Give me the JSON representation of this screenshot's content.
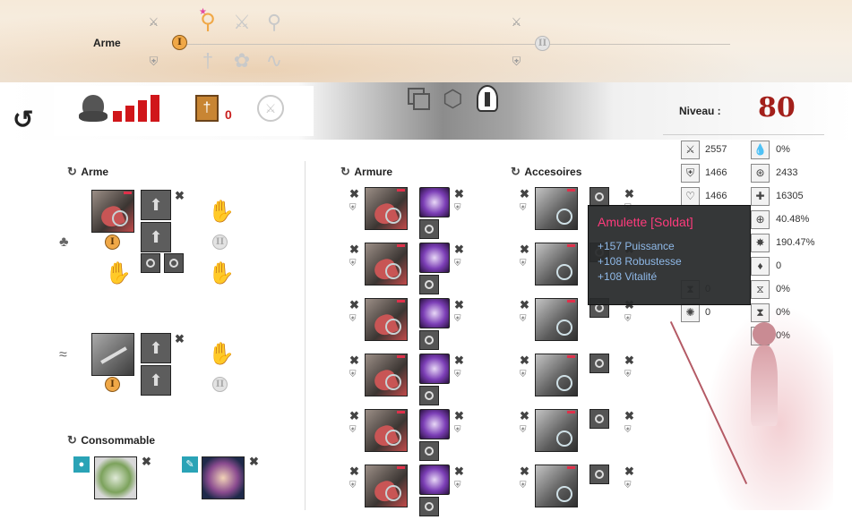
{
  "weapon_bar": {
    "label": "Arme",
    "set1_badge": "I",
    "set2_badge": "II",
    "icons": [
      "sigil-icon",
      "scepter-icon",
      "dagger-icon",
      "focus-icon",
      "sigil-icon",
      "dagger-icon",
      "fan-icon",
      "horn-icon",
      "sigil-icon",
      "sigil-icon"
    ]
  },
  "header": {
    "ascended_count": "0",
    "level_label": "Niveau :",
    "level_value": "80"
  },
  "sections": {
    "weapon_title": "Arme",
    "armor_title": "Armure",
    "accessories_title": "Accesoires",
    "consumables_title": "Consommable"
  },
  "weapon_slots": {
    "set1_badge": "I",
    "set2_badge": "II",
    "arrow_up": "⬆"
  },
  "stats": {
    "left": [
      "2557",
      "1466",
      "1466",
      "",
      "",
      "",
      "0",
      "0"
    ],
    "right": [
      "0%",
      "2433",
      "16305",
      "40.48%",
      "190.47%",
      "0",
      "0%",
      "0%",
      "0%"
    ]
  },
  "tooltip": {
    "title": "Amulette [Soldat]",
    "lines": [
      "+157 Puissance",
      "+108 Robustesse",
      "+108 Vitalité"
    ]
  },
  "colors": {
    "level": "#a3201b",
    "tooltip_title": "#ff3b7c",
    "tooltip_text": "#8fb9e8",
    "badge_active": "#f0a847"
  },
  "glyphs": {
    "close": "✖",
    "reset": "↻",
    "undo": "↺"
  }
}
